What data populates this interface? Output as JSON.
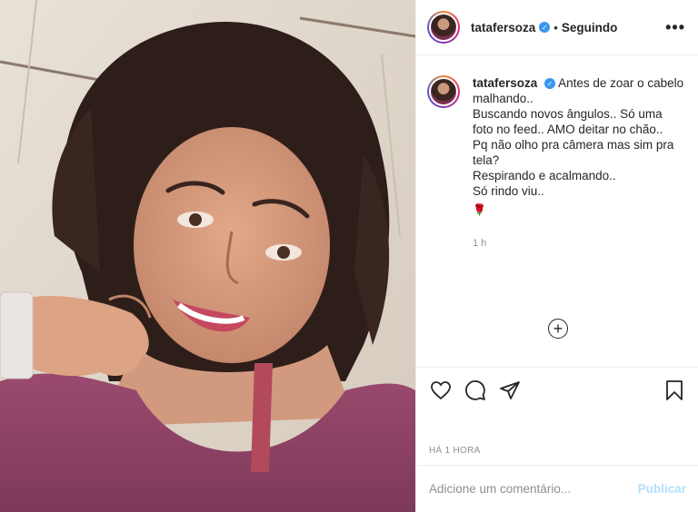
{
  "post": {
    "image_alt": "Selfie photo",
    "author": {
      "username": "tatafersoza",
      "verified": true,
      "follow_status": "Seguindo",
      "separator": "•"
    },
    "caption": {
      "username": "tatafersoza",
      "lines": [
        "Antes de zoar o cabelo",
        "malhando..",
        "Buscando novos ângulos.. Só uma",
        "foto no feed.. AMO deitar no chão..",
        "Pq não olho pra câmera mas sim pra",
        "tela?",
        "Respirando e acalmando..",
        "Só rindo viu.."
      ],
      "emoji": "🌹",
      "time": "1 h"
    },
    "posted_label": "HÁ 1 HORA",
    "comment": {
      "placeholder": "Adicione um comentário...",
      "value": "",
      "publish_label": "Publicar"
    },
    "icons": {
      "more": "more-options-icon",
      "like": "heart-icon",
      "comment": "comment-icon",
      "share": "share-icon",
      "save": "bookmark-icon",
      "add": "add-circle-icon"
    },
    "colors": {
      "verified": "#3897f0",
      "publish_disabled": "#b2dffc",
      "text": "#262626",
      "muted": "#8e8e8e"
    }
  }
}
